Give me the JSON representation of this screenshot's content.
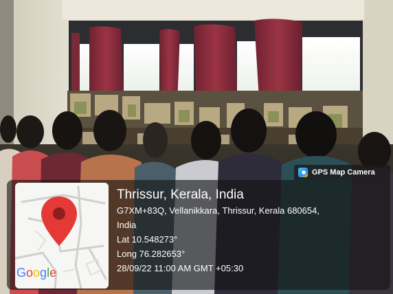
{
  "badge": {
    "label": "GPS Map Camera",
    "icon": "gps-map-camera-icon"
  },
  "location": {
    "title": "Thrissur, Kerala, India",
    "address_line1": "G7XM+83Q, Vellanikkara, Thrissur, Kerala 680654,",
    "address_line2": "India",
    "latitude": "Lat 10.548273°",
    "longitude": "Long 76.282653°",
    "datetime": "28/09/22 11:00 AM GMT +05:30"
  },
  "map": {
    "logo_letters": [
      "G",
      "o",
      "o",
      "g",
      "l",
      "e"
    ],
    "logo_colors": [
      "#4285F4",
      "#EA4335",
      "#FBBC05",
      "#4285F4",
      "#34A853",
      "#EA4335"
    ],
    "pin_color": "#E53935"
  },
  "colors": {
    "wall": "#d9d4c4",
    "curtain": "#8c2f3b",
    "window": "#f4f6f2",
    "panel_bg": "#141414"
  }
}
